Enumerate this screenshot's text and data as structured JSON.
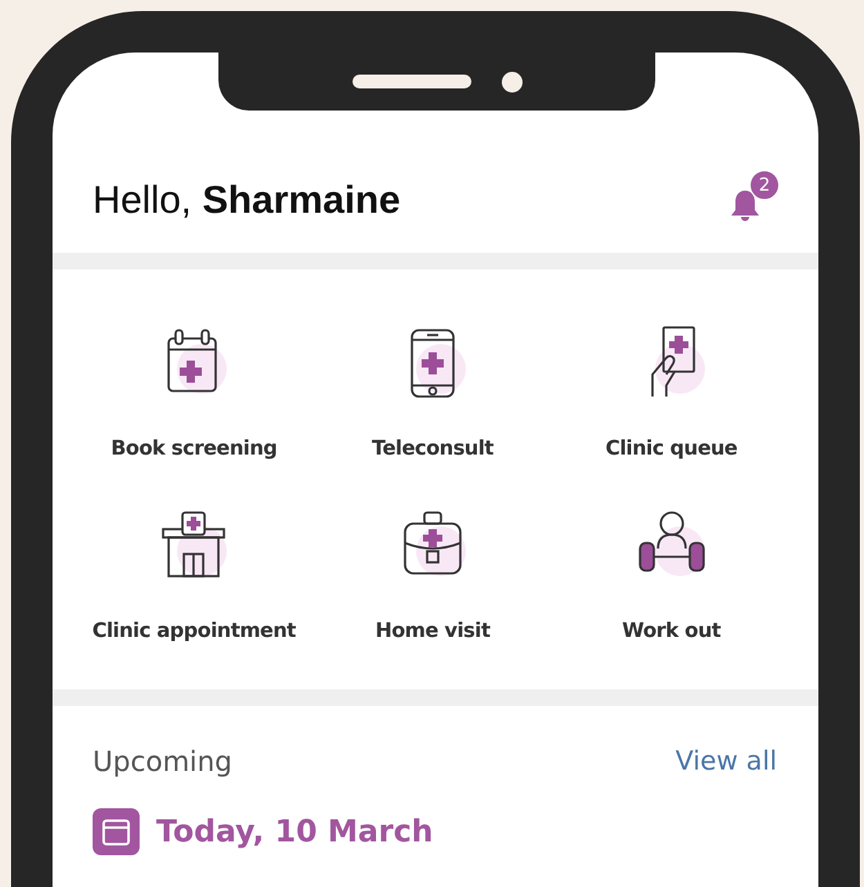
{
  "header": {
    "greeting": "Hello,",
    "name": "Sharmaine",
    "notification_count": "2"
  },
  "services": [
    {
      "label": "Book screening"
    },
    {
      "label": "Teleconsult"
    },
    {
      "label": "Clinic queue"
    },
    {
      "label": "Clinic appointment"
    },
    {
      "label": "Home visit"
    },
    {
      "label": "Work out"
    }
  ],
  "upcoming": {
    "title": "Upcoming",
    "link": "View all",
    "date": "Today, 10 March"
  }
}
